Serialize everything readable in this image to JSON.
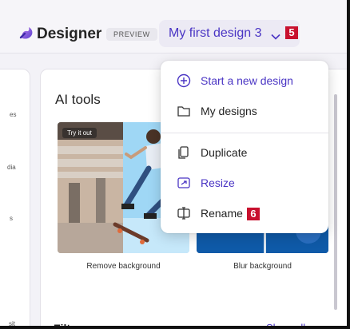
{
  "header": {
    "app_name": "Designer",
    "preview_label": "PREVIEW",
    "design_title": "My first design 3",
    "title_callout": "5"
  },
  "sidebar": {
    "items": [
      {
        "label": "es"
      },
      {
        "label": "dia"
      },
      {
        "label": "s"
      },
      {
        "label": "sit"
      }
    ]
  },
  "main": {
    "section_title": "AI tools",
    "tiles": [
      {
        "label": "Remove background",
        "tag": "Try it out"
      },
      {
        "label": "Blur background"
      }
    ],
    "filters_title": "Filters",
    "show_all": "Show all ›"
  },
  "menu": {
    "items": [
      {
        "label": "Start a new design",
        "icon": "plus-circle-icon"
      },
      {
        "label": "My designs",
        "icon": "folder-icon"
      },
      {
        "label": "Duplicate",
        "icon": "duplicate-icon"
      },
      {
        "label": "Resize",
        "icon": "resize-icon"
      },
      {
        "label": "Rename",
        "icon": "rename-icon"
      }
    ],
    "rename_callout": "6"
  },
  "colors": {
    "accent": "#4a35c4",
    "callout": "#c8102e"
  }
}
